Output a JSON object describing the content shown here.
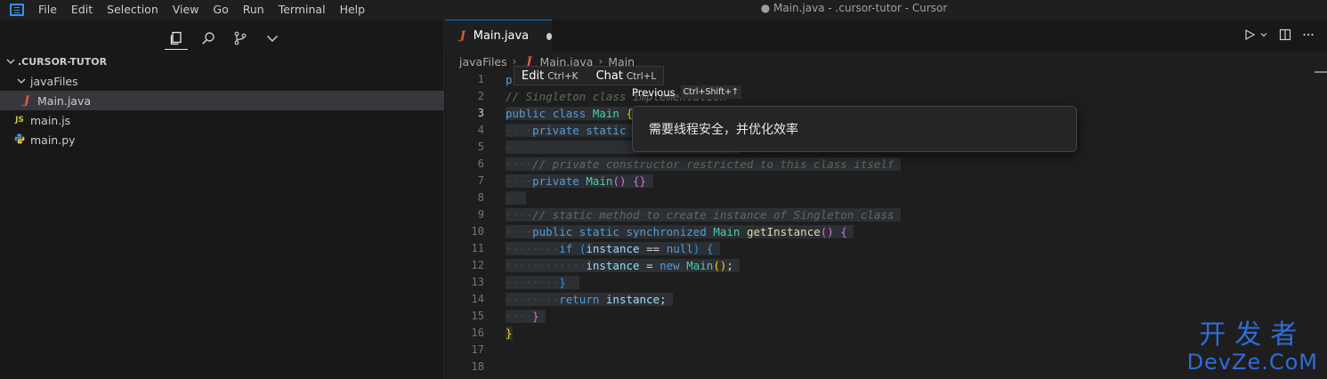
{
  "menu": [
    "File",
    "Edit",
    "Selection",
    "View",
    "Go",
    "Run",
    "Terminal",
    "Help"
  ],
  "window_title": "● Main.java - .cursor-tutor - Cursor",
  "sidebar": {
    "root": ".CURSOR-TUTOR",
    "folder": "javaFiles",
    "files": [
      {
        "name": "Main.java",
        "icon": "J",
        "kind": "java"
      },
      {
        "name": "main.js",
        "icon": "JS",
        "kind": "js"
      },
      {
        "name": "main.py",
        "icon": "python-icon",
        "kind": "py"
      }
    ]
  },
  "tab": {
    "label": "Main.java",
    "icon": "J"
  },
  "breadcrumb": {
    "folder": "javaFiles",
    "file": "Main.java",
    "symbol": "Main",
    "icon": "J"
  },
  "line_numbers": [
    "1",
    "2",
    "3",
    "4",
    "5",
    "6",
    "7",
    "8",
    "9",
    "10",
    "11",
    "12",
    "13",
    "14",
    "15",
    "16",
    "17",
    "18"
  ],
  "current_line": 3,
  "inline_toolbar": {
    "edit_label": "Edit",
    "edit_kbd": "Ctrl+K",
    "chat_label": "Chat",
    "chat_kbd": "Ctrl+L"
  },
  "previous_hint": {
    "label": "Previous",
    "kbd": "Ctrl+Shift+↑"
  },
  "prompt_text": "需要线程安全，并优化效率",
  "code": {
    "l1": "p",
    "l2": "// Singleton class implementation",
    "l3a": "public",
    "l3b": "class",
    "l3c": "Main",
    "l4a": "private",
    "l4b": "static",
    "l6": "// private constructor restricted to this class itself",
    "l7a": "private",
    "l7b": "Main",
    "l9": "// static method to create instance of Singleton class",
    "l10a": "public",
    "l10b": "static",
    "l10c": "synchronized",
    "l10d": "Main",
    "l10e": "getInstance",
    "l11a": "if",
    "l11b": "instance",
    "l11c": "==",
    "l11d": "null",
    "l12a": "instance",
    "l12b": "=",
    "l12c": "new",
    "l12d": "Main",
    "l14a": "return",
    "l14b": "instance"
  },
  "watermark": {
    "top": "开发者",
    "bottom": "DevZe.CoM"
  },
  "colors": {
    "accent": "#0078d4",
    "java": "#e05d44",
    "js": "#cbcb41",
    "watermark": "#2f6cd6"
  }
}
